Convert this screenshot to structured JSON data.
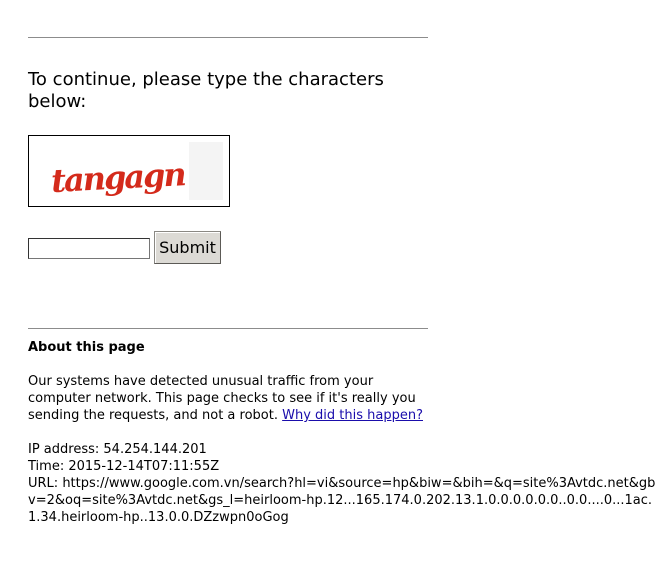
{
  "page": {
    "heading": "To continue, please type the characters below:"
  },
  "captcha": {
    "text": "tangagn",
    "text_color": "#d42a1b"
  },
  "form": {
    "input_value": "",
    "submit_label": "Submit"
  },
  "about": {
    "title": "About this page",
    "explanation": "Our systems have detected unusual traffic from your computer network. This page checks to see if it's really you sending the requests, and not a robot.",
    "link_text": "Why did this happen?",
    "ip_label": "IP address:",
    "ip_value": "54.254.144.201",
    "time_label": "Time:",
    "time_value": "2015-12-14T07:11:55Z",
    "url_label": "URL:",
    "url_value": "https://www.google.com.vn/search?hl=vi&source=hp&biw=&bih=&q=site%3Avtdc.net&gbv=2&oq=site%3Avtdc.net&gs_l=heirloom-hp.12...165.174.0.202.13.1.0.0.0.0.0.0..0.0....0...1ac.1.34.heirloom-hp..13.0.0.DZzwpn0oGog"
  },
  "colors": {
    "link": "#1a0dab",
    "rule": "#8c8c8c",
    "button_face": "#dcdad5"
  }
}
